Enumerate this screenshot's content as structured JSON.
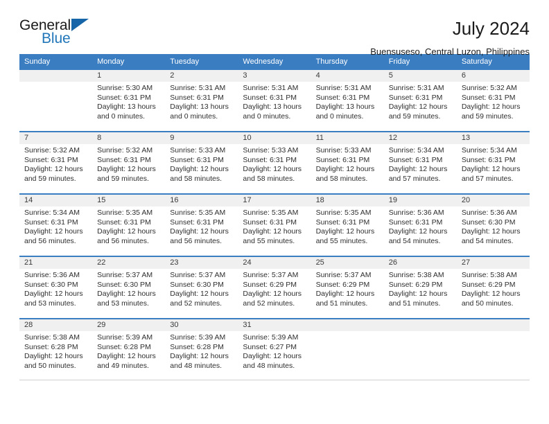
{
  "brand": {
    "name_part1": "General",
    "name_part2": "Blue",
    "triangle_color": "#1565a8",
    "blue_color": "#2176b9"
  },
  "header": {
    "title": "July 2024",
    "subtitle": "Buensuseso, Central Luzon, Philippines"
  },
  "calendar": {
    "accent_color": "#3b7dc1",
    "daynum_band_color": "#f0f0f0",
    "weekdays": [
      "Sunday",
      "Monday",
      "Tuesday",
      "Wednesday",
      "Thursday",
      "Friday",
      "Saturday"
    ],
    "weeks": [
      [
        {
          "day": "",
          "sunrise": "",
          "sunset": "",
          "daylight_line1": "",
          "daylight_line2": ""
        },
        {
          "day": "1",
          "sunrise": "Sunrise: 5:30 AM",
          "sunset": "Sunset: 6:31 PM",
          "daylight_line1": "Daylight: 13 hours",
          "daylight_line2": "and 0 minutes."
        },
        {
          "day": "2",
          "sunrise": "Sunrise: 5:31 AM",
          "sunset": "Sunset: 6:31 PM",
          "daylight_line1": "Daylight: 13 hours",
          "daylight_line2": "and 0 minutes."
        },
        {
          "day": "3",
          "sunrise": "Sunrise: 5:31 AM",
          "sunset": "Sunset: 6:31 PM",
          "daylight_line1": "Daylight: 13 hours",
          "daylight_line2": "and 0 minutes."
        },
        {
          "day": "4",
          "sunrise": "Sunrise: 5:31 AM",
          "sunset": "Sunset: 6:31 PM",
          "daylight_line1": "Daylight: 13 hours",
          "daylight_line2": "and 0 minutes."
        },
        {
          "day": "5",
          "sunrise": "Sunrise: 5:31 AM",
          "sunset": "Sunset: 6:31 PM",
          "daylight_line1": "Daylight: 12 hours",
          "daylight_line2": "and 59 minutes."
        },
        {
          "day": "6",
          "sunrise": "Sunrise: 5:32 AM",
          "sunset": "Sunset: 6:31 PM",
          "daylight_line1": "Daylight: 12 hours",
          "daylight_line2": "and 59 minutes."
        }
      ],
      [
        {
          "day": "7",
          "sunrise": "Sunrise: 5:32 AM",
          "sunset": "Sunset: 6:31 PM",
          "daylight_line1": "Daylight: 12 hours",
          "daylight_line2": "and 59 minutes."
        },
        {
          "day": "8",
          "sunrise": "Sunrise: 5:32 AM",
          "sunset": "Sunset: 6:31 PM",
          "daylight_line1": "Daylight: 12 hours",
          "daylight_line2": "and 59 minutes."
        },
        {
          "day": "9",
          "sunrise": "Sunrise: 5:33 AM",
          "sunset": "Sunset: 6:31 PM",
          "daylight_line1": "Daylight: 12 hours",
          "daylight_line2": "and 58 minutes."
        },
        {
          "day": "10",
          "sunrise": "Sunrise: 5:33 AM",
          "sunset": "Sunset: 6:31 PM",
          "daylight_line1": "Daylight: 12 hours",
          "daylight_line2": "and 58 minutes."
        },
        {
          "day": "11",
          "sunrise": "Sunrise: 5:33 AM",
          "sunset": "Sunset: 6:31 PM",
          "daylight_line1": "Daylight: 12 hours",
          "daylight_line2": "and 58 minutes."
        },
        {
          "day": "12",
          "sunrise": "Sunrise: 5:34 AM",
          "sunset": "Sunset: 6:31 PM",
          "daylight_line1": "Daylight: 12 hours",
          "daylight_line2": "and 57 minutes."
        },
        {
          "day": "13",
          "sunrise": "Sunrise: 5:34 AM",
          "sunset": "Sunset: 6:31 PM",
          "daylight_line1": "Daylight: 12 hours",
          "daylight_line2": "and 57 minutes."
        }
      ],
      [
        {
          "day": "14",
          "sunrise": "Sunrise: 5:34 AM",
          "sunset": "Sunset: 6:31 PM",
          "daylight_line1": "Daylight: 12 hours",
          "daylight_line2": "and 56 minutes."
        },
        {
          "day": "15",
          "sunrise": "Sunrise: 5:35 AM",
          "sunset": "Sunset: 6:31 PM",
          "daylight_line1": "Daylight: 12 hours",
          "daylight_line2": "and 56 minutes."
        },
        {
          "day": "16",
          "sunrise": "Sunrise: 5:35 AM",
          "sunset": "Sunset: 6:31 PM",
          "daylight_line1": "Daylight: 12 hours",
          "daylight_line2": "and 56 minutes."
        },
        {
          "day": "17",
          "sunrise": "Sunrise: 5:35 AM",
          "sunset": "Sunset: 6:31 PM",
          "daylight_line1": "Daylight: 12 hours",
          "daylight_line2": "and 55 minutes."
        },
        {
          "day": "18",
          "sunrise": "Sunrise: 5:35 AM",
          "sunset": "Sunset: 6:31 PM",
          "daylight_line1": "Daylight: 12 hours",
          "daylight_line2": "and 55 minutes."
        },
        {
          "day": "19",
          "sunrise": "Sunrise: 5:36 AM",
          "sunset": "Sunset: 6:31 PM",
          "daylight_line1": "Daylight: 12 hours",
          "daylight_line2": "and 54 minutes."
        },
        {
          "day": "20",
          "sunrise": "Sunrise: 5:36 AM",
          "sunset": "Sunset: 6:30 PM",
          "daylight_line1": "Daylight: 12 hours",
          "daylight_line2": "and 54 minutes."
        }
      ],
      [
        {
          "day": "21",
          "sunrise": "Sunrise: 5:36 AM",
          "sunset": "Sunset: 6:30 PM",
          "daylight_line1": "Daylight: 12 hours",
          "daylight_line2": "and 53 minutes."
        },
        {
          "day": "22",
          "sunrise": "Sunrise: 5:37 AM",
          "sunset": "Sunset: 6:30 PM",
          "daylight_line1": "Daylight: 12 hours",
          "daylight_line2": "and 53 minutes."
        },
        {
          "day": "23",
          "sunrise": "Sunrise: 5:37 AM",
          "sunset": "Sunset: 6:30 PM",
          "daylight_line1": "Daylight: 12 hours",
          "daylight_line2": "and 52 minutes."
        },
        {
          "day": "24",
          "sunrise": "Sunrise: 5:37 AM",
          "sunset": "Sunset: 6:29 PM",
          "daylight_line1": "Daylight: 12 hours",
          "daylight_line2": "and 52 minutes."
        },
        {
          "day": "25",
          "sunrise": "Sunrise: 5:37 AM",
          "sunset": "Sunset: 6:29 PM",
          "daylight_line1": "Daylight: 12 hours",
          "daylight_line2": "and 51 minutes."
        },
        {
          "day": "26",
          "sunrise": "Sunrise: 5:38 AM",
          "sunset": "Sunset: 6:29 PM",
          "daylight_line1": "Daylight: 12 hours",
          "daylight_line2": "and 51 minutes."
        },
        {
          "day": "27",
          "sunrise": "Sunrise: 5:38 AM",
          "sunset": "Sunset: 6:29 PM",
          "daylight_line1": "Daylight: 12 hours",
          "daylight_line2": "and 50 minutes."
        }
      ],
      [
        {
          "day": "28",
          "sunrise": "Sunrise: 5:38 AM",
          "sunset": "Sunset: 6:28 PM",
          "daylight_line1": "Daylight: 12 hours",
          "daylight_line2": "and 50 minutes."
        },
        {
          "day": "29",
          "sunrise": "Sunrise: 5:39 AM",
          "sunset": "Sunset: 6:28 PM",
          "daylight_line1": "Daylight: 12 hours",
          "daylight_line2": "and 49 minutes."
        },
        {
          "day": "30",
          "sunrise": "Sunrise: 5:39 AM",
          "sunset": "Sunset: 6:28 PM",
          "daylight_line1": "Daylight: 12 hours",
          "daylight_line2": "and 48 minutes."
        },
        {
          "day": "31",
          "sunrise": "Sunrise: 5:39 AM",
          "sunset": "Sunset: 6:27 PM",
          "daylight_line1": "Daylight: 12 hours",
          "daylight_line2": "and 48 minutes."
        },
        {
          "day": "",
          "sunrise": "",
          "sunset": "",
          "daylight_line1": "",
          "daylight_line2": ""
        },
        {
          "day": "",
          "sunrise": "",
          "sunset": "",
          "daylight_line1": "",
          "daylight_line2": ""
        },
        {
          "day": "",
          "sunrise": "",
          "sunset": "",
          "daylight_line1": "",
          "daylight_line2": ""
        }
      ]
    ]
  }
}
